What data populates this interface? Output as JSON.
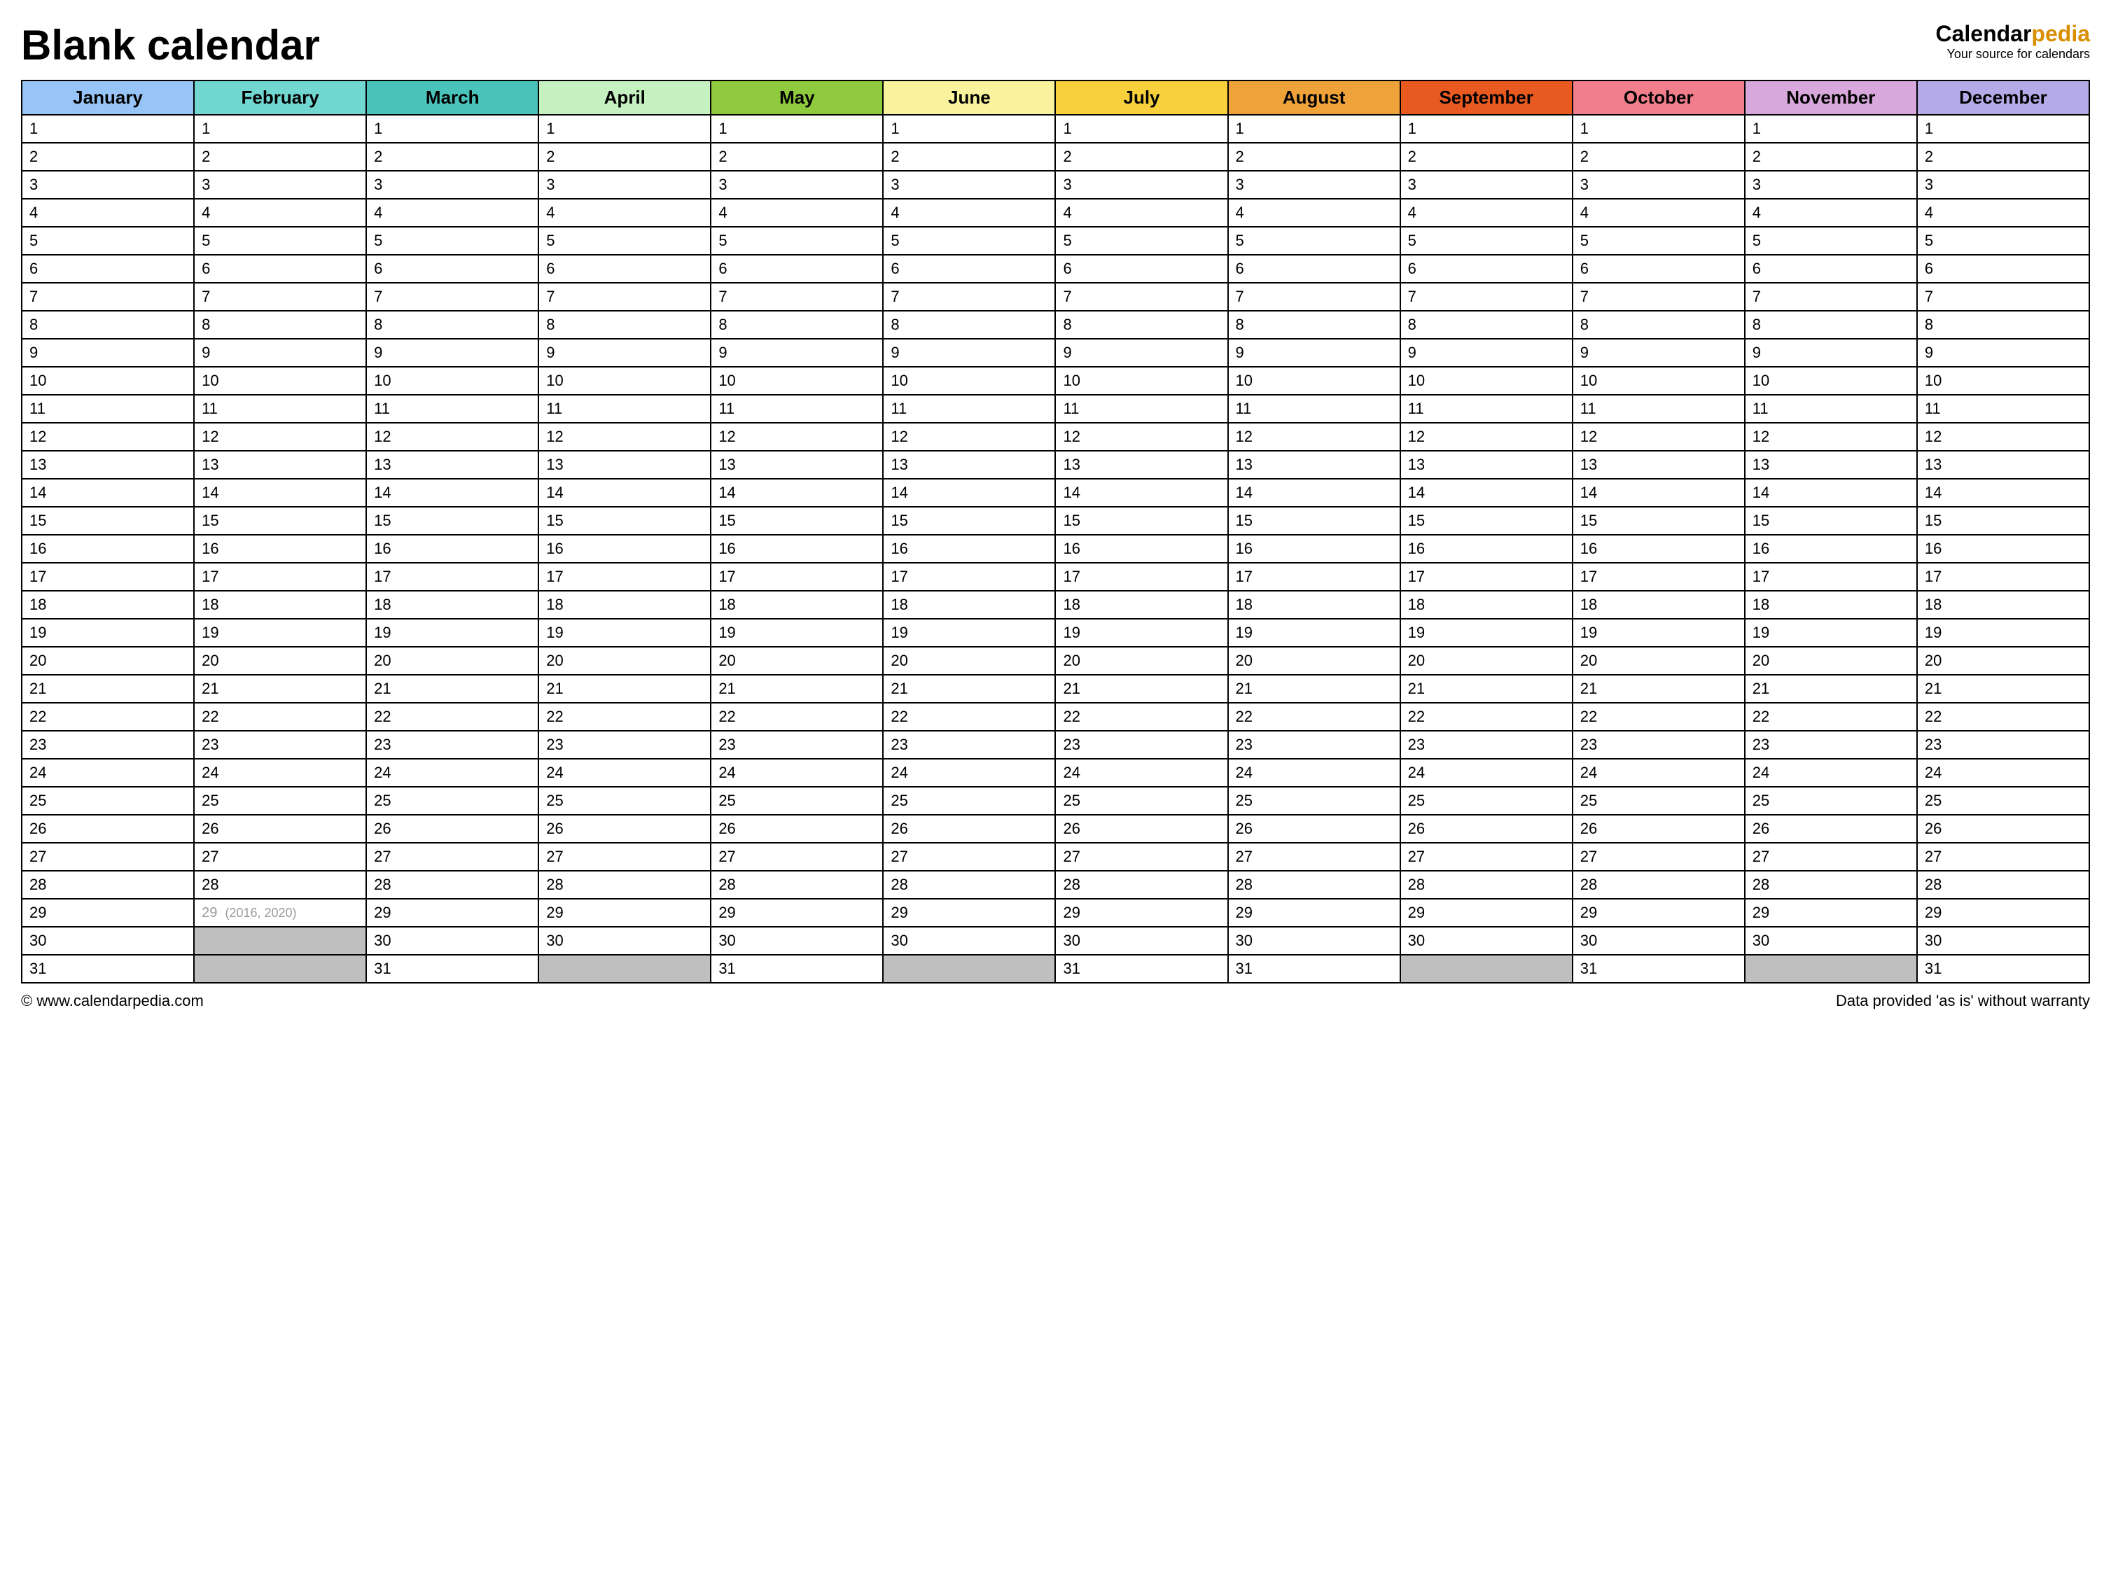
{
  "header": {
    "title": "Blank calendar",
    "brand_name_part1": "Calendar",
    "brand_name_part2": "pedia",
    "brand_tagline": "Your source for calendars"
  },
  "months": [
    {
      "name": "January",
      "color": "#97c5f7",
      "days": 31,
      "special29": false
    },
    {
      "name": "February",
      "color": "#72d7d1",
      "days": 29,
      "special29": true,
      "note29": "(2016, 2020)"
    },
    {
      "name": "March",
      "color": "#4ac4ba",
      "days": 31,
      "special29": false
    },
    {
      "name": "April",
      "color": "#c5f0c0",
      "days": 30,
      "special29": false
    },
    {
      "name": "May",
      "color": "#8ec93e",
      "days": 31,
      "special29": false
    },
    {
      "name": "June",
      "color": "#f8f39c",
      "days": 30,
      "special29": false
    },
    {
      "name": "July",
      "color": "#f7d03c",
      "days": 31,
      "special29": false
    },
    {
      "name": "August",
      "color": "#efa23a",
      "days": 31,
      "special29": false
    },
    {
      "name": "September",
      "color": "#e95a21",
      "days": 30,
      "special29": false
    },
    {
      "name": "October",
      "color": "#f07e8b",
      "days": 31,
      "special29": false
    },
    {
      "name": "November",
      "color": "#d8a7dc",
      "days": 30,
      "special29": false
    },
    {
      "name": "December",
      "color": "#b4aae8",
      "days": 31,
      "special29": false
    }
  ],
  "max_days": 31,
  "footer": {
    "left": "© www.calendarpedia.com",
    "right": "Data provided 'as is' without warranty"
  }
}
